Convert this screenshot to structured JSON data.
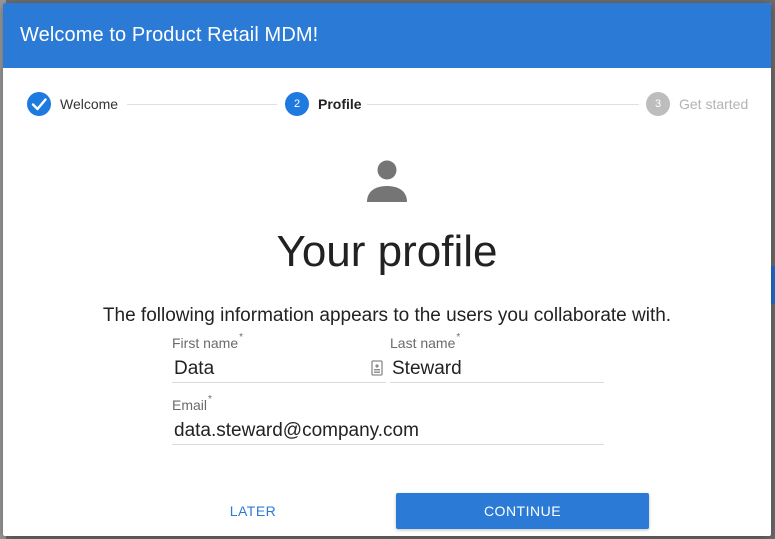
{
  "dialog": {
    "title": "Welcome to Product Retail MDM!"
  },
  "stepper": {
    "steps": [
      {
        "number": "",
        "label": "Welcome",
        "state": "done"
      },
      {
        "number": "2",
        "label": "Profile",
        "state": "active"
      },
      {
        "number": "3",
        "label": "Get started",
        "state": "pending"
      }
    ]
  },
  "profile": {
    "icon": "person-icon",
    "title": "Your profile",
    "subtitle": "The following information appears to the users you collaborate with."
  },
  "form": {
    "first_name": {
      "label": "First name",
      "required_mark": "*",
      "value": "Data"
    },
    "last_name": {
      "label": "Last name",
      "required_mark": "*",
      "value": "Steward"
    },
    "email": {
      "label": "Email",
      "required_mark": "*",
      "value": "data.steward@company.com"
    }
  },
  "actions": {
    "later_label": "LATER",
    "continue_label": "CONTINUE"
  },
  "colors": {
    "primary": "#2b7bd6",
    "pending": "#bdbdbd"
  }
}
